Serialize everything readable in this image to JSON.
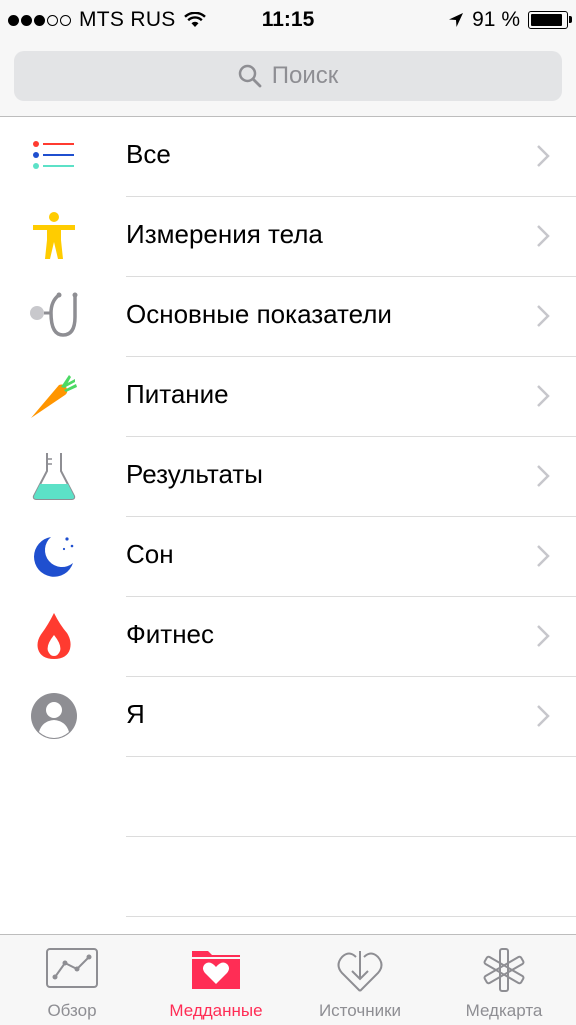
{
  "status_bar": {
    "carrier": "MTS RUS",
    "time": "11:15",
    "battery": "91 %",
    "battery_level": 0.91,
    "signal_bars_filled": 3,
    "signal_bars_total": 5
  },
  "search": {
    "placeholder": "Поиск"
  },
  "categories": [
    {
      "label": "Все",
      "icon": "list-icon"
    },
    {
      "label": "Измерения тела",
      "icon": "body-figure-icon"
    },
    {
      "label": "Основные показатели",
      "icon": "stethoscope-icon"
    },
    {
      "label": "Питание",
      "icon": "carrot-icon"
    },
    {
      "label": "Результаты",
      "icon": "flask-icon"
    },
    {
      "label": "Сон",
      "icon": "moon-icon"
    },
    {
      "label": "Фитнес",
      "icon": "flame-icon"
    },
    {
      "label": "Я",
      "icon": "person-icon"
    }
  ],
  "tabs": [
    {
      "label": "Обзор",
      "icon": "chart-icon",
      "active": false
    },
    {
      "label": "Медданные",
      "icon": "folder-heart-icon",
      "active": true
    },
    {
      "label": "Источники",
      "icon": "download-heart-icon",
      "active": false
    },
    {
      "label": "Медкарта",
      "icon": "asterisk-icon",
      "active": false
    }
  ],
  "colors": {
    "accent": "#ff2d55",
    "inactive": "#8e8e93",
    "body_icon": "#ffcc00",
    "carrot": "#ff9500",
    "flask": "#5ce1c7",
    "moon": "#1f4fcf",
    "flame": "#ff3b30",
    "person": "#8e8e93"
  }
}
